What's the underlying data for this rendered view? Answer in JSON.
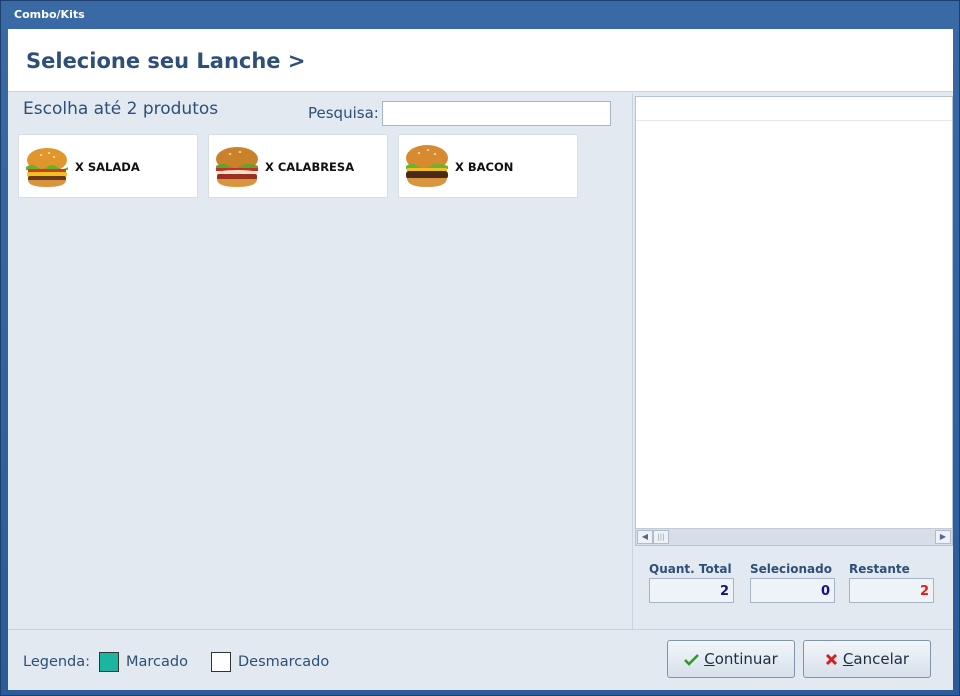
{
  "window": {
    "title": "Combo/Kits"
  },
  "header": {
    "title": "Selecione seu Lanche >"
  },
  "left": {
    "choose_label": "Escolha até 2 produtos",
    "search_label": "Pesquisa:",
    "search_value": "",
    "products": [
      {
        "name": "X SALADA",
        "icon": "burger-salad-icon"
      },
      {
        "name": "X CALABRESA",
        "icon": "burger-calabresa-icon"
      },
      {
        "name": "X BACON",
        "icon": "burger-bacon-icon"
      }
    ]
  },
  "summary": {
    "total_label": "Quant. Total",
    "total_value": "2",
    "selected_label": "Selecionado",
    "selected_value": "0",
    "remaining_label": "Restante",
    "remaining_value": "2"
  },
  "legend": {
    "label": "Legenda:",
    "checked": "Marcado",
    "unchecked": "Desmarcado"
  },
  "buttons": {
    "continue_accel": "C",
    "continue_rest": "ontinuar",
    "cancel_accel": "C",
    "cancel_rest": "ancelar"
  },
  "colors": {
    "checked": "#1bb5a1",
    "unchecked": "#ffffff",
    "remaining": "#e31b1b",
    "selected": "#10147a",
    "heading": "#2e4f78"
  }
}
